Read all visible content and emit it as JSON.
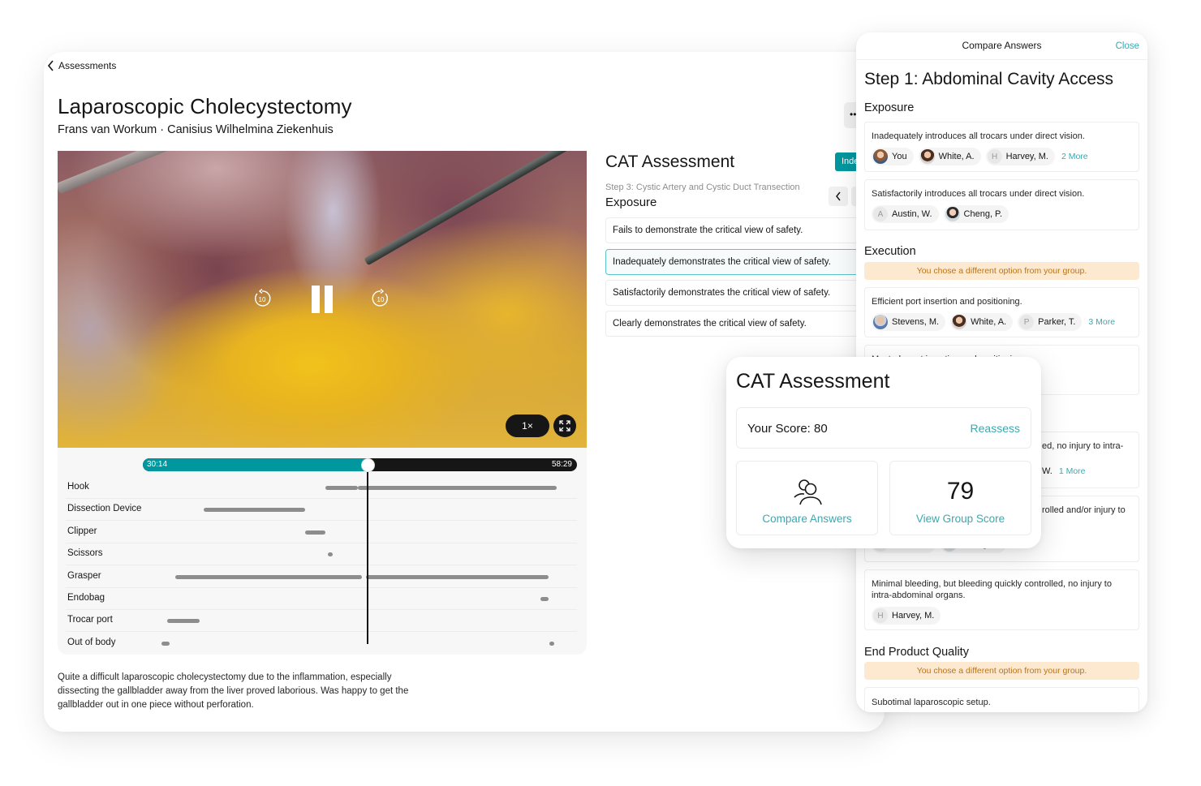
{
  "header": {
    "back_label": "Assessments",
    "title": "Laparoscopic Cholecystectomy",
    "subtitle": "Frans van Workum · Canisius Wilhelmina Ziekenhuis"
  },
  "video": {
    "rewind_seconds": "10",
    "forward_seconds": "10",
    "speed": "1×",
    "current_time": "30:14",
    "total_time": "58:29",
    "progress": 0.517
  },
  "timeline": {
    "tracks": [
      {
        "label": "Hook",
        "segments": [
          [
            0.41,
            0.49
          ],
          [
            0.49,
            0.98
          ]
        ]
      },
      {
        "label": "Dissection Device",
        "segments": [
          [
            0.11,
            0.36
          ]
        ]
      },
      {
        "label": "Clipper",
        "segments": [
          [
            0.36,
            0.41
          ]
        ]
      },
      {
        "label": "Scissors",
        "segments": [
          [
            0.415,
            0.425
          ]
        ]
      },
      {
        "label": "Grasper",
        "segments": [
          [
            0.04,
            0.5
          ],
          [
            0.51,
            0.96
          ]
        ]
      },
      {
        "label": "Endobag",
        "segments": [
          [
            0.94,
            0.96
          ]
        ]
      },
      {
        "label": "Trocar port",
        "segments": [
          [
            0.02,
            0.1
          ]
        ]
      },
      {
        "label": "Out of body",
        "segments": [
          [
            0.005,
            0.025
          ],
          [
            0.962,
            0.97
          ]
        ]
      }
    ]
  },
  "description": "Quite a difficult laparoscopic cholecystectomy due to the inflammation, especially dissecting the gallbladder away from the liver proved laborious. Was happy to get the gallbladder out in one piece without perforation.",
  "cat": {
    "title": "CAT Assessment",
    "index_button": "Index",
    "more_button": "•••",
    "step_label": "Step 3: Cystic Artery and Cystic Duct Transection",
    "section": "Exposure",
    "options": [
      {
        "text": "Fails to demonstrate the critical view of safety.",
        "selected": false
      },
      {
        "text": "Inadequately demonstrates the critical view of safety.",
        "selected": true
      },
      {
        "text": "Satisfactorily demonstrates the critical view of safety.",
        "selected": false
      },
      {
        "text": "Clearly demonstrates the critical view of safety.",
        "selected": false
      }
    ]
  },
  "compare": {
    "title": "Compare Answers",
    "close": "Close",
    "step": "Step 1: Abdominal Cavity Access",
    "sections": {
      "exposure": "Exposure",
      "execution": "Execution",
      "end_product": "End Product Quality"
    },
    "warning": "You chose a different option from your group.",
    "cards": [
      {
        "text": "Inadequately introduces all trocars under direct vision.",
        "chips": [
          {
            "name": "You",
            "avatar": "photo"
          },
          {
            "name": "White, A.",
            "avatar": "photo"
          },
          {
            "name": "Harvey, M.",
            "initial": "H"
          }
        ],
        "more": "2 More"
      },
      {
        "text": "Satisfactorily introduces all trocars under direct vision.",
        "chips": [
          {
            "name": "Austin, W.",
            "initial": "A"
          },
          {
            "name": "Cheng, P.",
            "avatar": "photo"
          }
        ]
      },
      {
        "text": "Efficient port insertion and positioning.",
        "chips": [
          {
            "name": "Stevens, M.",
            "avatar": "photo"
          },
          {
            "name": "White, A.",
            "avatar": "photo"
          },
          {
            "name": "Parker, T.",
            "initial": "P"
          }
        ],
        "more": "3 More"
      },
      {
        "text": "Masterly port insertion and positioning."
      },
      {
        "text_partial": "ed, no injury to intra-",
        "chip_partial": "W.",
        "more": "1 More"
      },
      {
        "text_partial": "rolled and/or injury to",
        "chips": [
          {
            "name": "Parker, T."
          },
          {
            "name": "Cheng, P."
          }
        ]
      },
      {
        "text": "Minimal bleeding, but bleeding quickly controlled, no injury to intra-abdominal organs.",
        "chips": [
          {
            "name": "Harvey, M.",
            "initial": "H"
          }
        ]
      },
      {
        "text": "Subotimal laparoscopic setup."
      }
    ]
  },
  "score_popup": {
    "title": "CAT Assessment",
    "your_score": "Your Score: 80",
    "reassess": "Reassess",
    "compare_label": "Compare Answers",
    "group_score": "79",
    "group_label": "View Group Score"
  },
  "colors": {
    "accent": "#00979f",
    "link": "#3aa9b0",
    "warning_bg": "#fde9cf",
    "warning_text": "#b8741a"
  }
}
